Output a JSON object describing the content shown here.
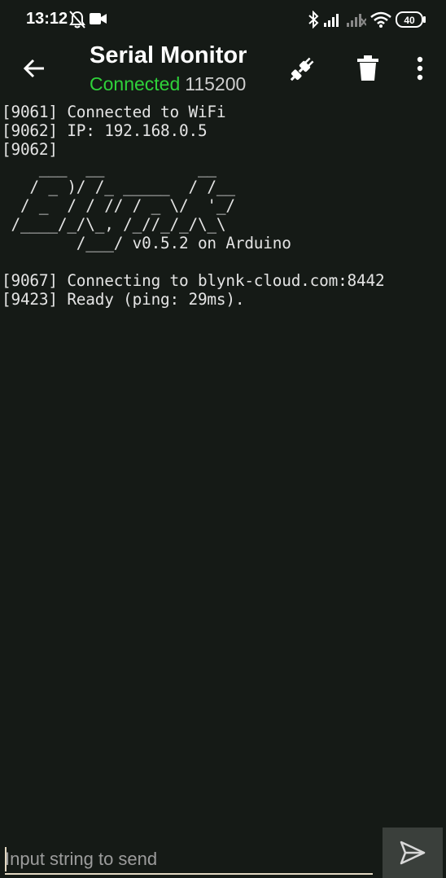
{
  "status_bar": {
    "time": "13:12",
    "battery": "40",
    "icons": [
      "notifications-off-icon",
      "video-camera-icon",
      "bluetooth-icon",
      "signal-icon",
      "signal-weak-icon",
      "wifi-icon",
      "battery-icon"
    ]
  },
  "app_bar": {
    "title": "Serial Monitor",
    "connection_status": "Connected",
    "baud_rate": "115200",
    "status_color": "#2fd13a",
    "back_icon": "arrow-left-icon",
    "actions": [
      {
        "icon": "plug-disconnect-icon"
      },
      {
        "icon": "trash-icon"
      },
      {
        "icon": "more-vertical-icon"
      }
    ]
  },
  "terminal": {
    "lines": [
      "[9061] Connected to WiFi",
      "[9062] IP: 192.168.0.5",
      "[9062] ",
      "    ___  __          __",
      "   / _ )/ /_ _____  / /__",
      "  / _  / / // / _ \\/  '_/",
      " /____/_/\\_, /_//_/_/\\_\\",
      "        /___/ v0.5.2 on Arduino",
      "",
      "[9067] Connecting to blynk-cloud.com:8442",
      "[9423] Ready (ping: 29ms)."
    ]
  },
  "input": {
    "placeholder": "Input string to send",
    "value": "",
    "send_icon": "send-icon"
  }
}
